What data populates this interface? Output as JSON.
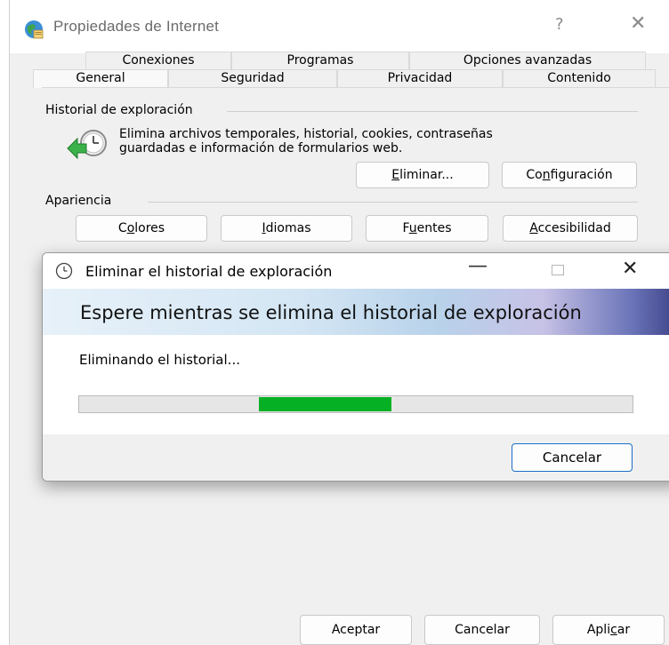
{
  "main_window": {
    "title": "Propiedades de Internet",
    "help": "?",
    "close": "✕",
    "tabs_row1": [
      "Conexiones",
      "Programas",
      "Opciones avanzadas"
    ],
    "tabs_row2": [
      "General",
      "Seguridad",
      "Privacidad",
      "Contenido"
    ],
    "active_tab": "General",
    "history_group": {
      "label": "Historial de exploración",
      "description_line1": "Elimina archivos temporales, historial, cookies, contraseñas",
      "description_line2": "guardadas e información de formularios web.",
      "delete_button": {
        "mnemonic": "E",
        "rest": "liminar..."
      },
      "settings_button": {
        "before": "Co",
        "mnemonic": "n",
        "after": "figuración"
      }
    },
    "appearance_group": {
      "label": "Apariencia",
      "colors_button": {
        "before": "C",
        "mnemonic": "o",
        "after": "lores"
      },
      "languages_button": {
        "before": "",
        "mnemonic": "I",
        "after": "diomas"
      },
      "fonts_button": {
        "before": "F",
        "mnemonic": "u",
        "after": "entes"
      },
      "accessibility_button": {
        "before": "",
        "mnemonic": "A",
        "after": "ccesibilidad"
      }
    },
    "bottom_buttons": {
      "ok": "Aceptar",
      "cancel": "Cancelar",
      "apply": {
        "before": "Apli",
        "mnemonic": "c",
        "after": "ar"
      }
    }
  },
  "dialog": {
    "title": "Eliminar el historial de exploración",
    "minimize": "—",
    "close": "✕",
    "banner_text": "Espere mientras se elimina el historial de exploración",
    "status_text": "Eliminando el historial...",
    "progress": {
      "indeterminate": true,
      "segment_start": 0.325,
      "segment_end": 0.565,
      "color": "#06b025"
    },
    "cancel_label": "Cancelar"
  },
  "colors": {
    "accent": "#1a6fc8",
    "progress": "#06b025"
  },
  "icons": [
    "globe-icon",
    "history-clock-icon",
    "clock-icon"
  ]
}
